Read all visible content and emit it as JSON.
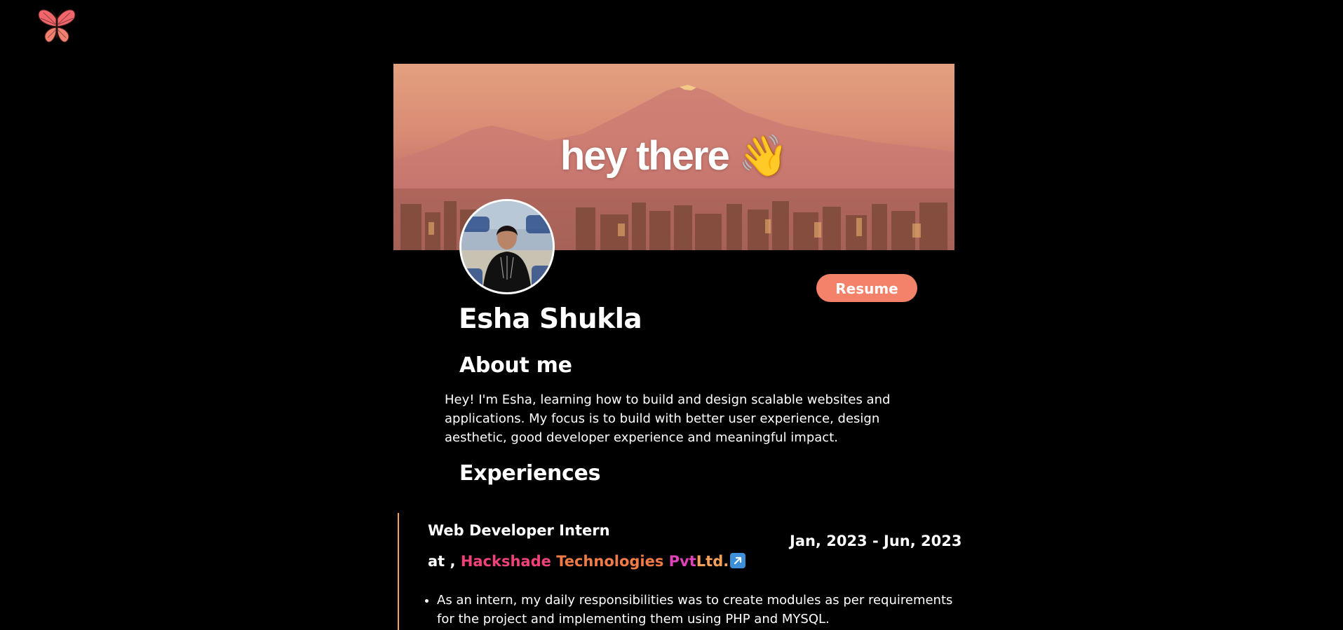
{
  "header": {
    "logo_icon": "butterfly-icon"
  },
  "banner": {
    "text": "hey there",
    "emoji": "👋"
  },
  "profile": {
    "name": "Esha Shukla",
    "resume_label": "Resume"
  },
  "about": {
    "title": "About me",
    "text": "Hey! I'm Esha, learning how to build and design scalable websites and applications. My focus is to build with better user experience, design aesthetic, good developer experience and meaningful impact."
  },
  "experiences": {
    "title": "Experiences",
    "items": [
      {
        "role": "Web Developer Intern",
        "at": "at ,",
        "company_parts": [
          "Hackshade",
          "Technologies",
          "Pvt",
          "Ltd."
        ],
        "date": "Jan, 2023 - Jun, 2023",
        "bullets": [
          "As an intern, my daily responsibilities was to create modules as per requirements for the project and implementing them using PHP and MYSQL."
        ]
      }
    ]
  },
  "colors": {
    "accent": "#f4826a",
    "timeline": "#f7a35c",
    "background": "#000000"
  }
}
